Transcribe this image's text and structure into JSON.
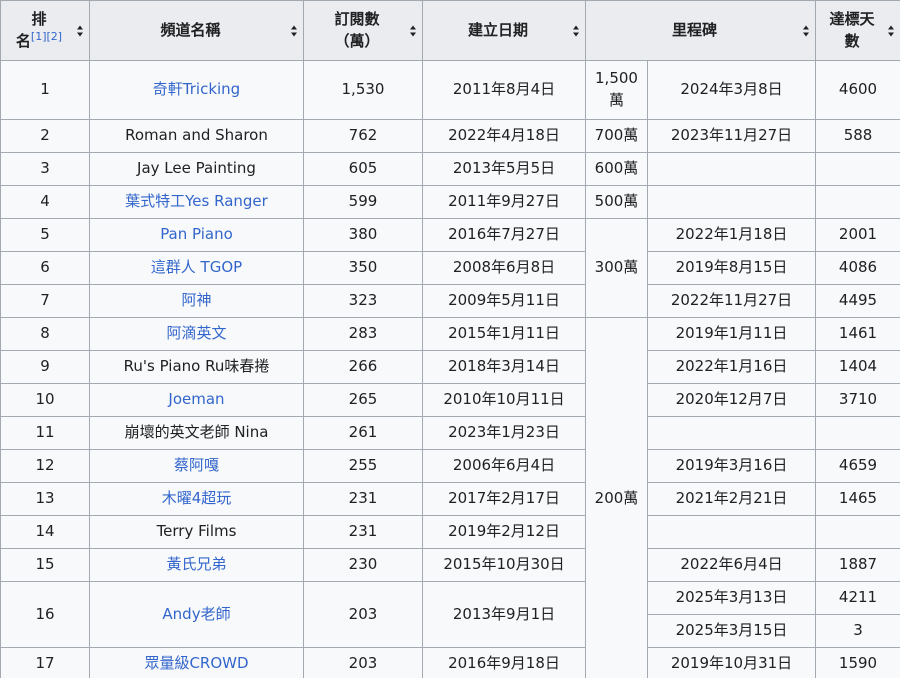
{
  "headers": {
    "rank_line1": "排",
    "rank_line2": "名",
    "rank_ref1": "[1]",
    "rank_ref2": "[2]",
    "channel": "頻道名稱",
    "subs_line1": "訂閱數",
    "subs_line2": "（萬）",
    "created": "建立日期",
    "milestone": "里程碑",
    "days_line1": "達標天",
    "days_line2": "數"
  },
  "milestone_groups": {
    "m1500_line1": "1,500",
    "m1500_line2": "萬",
    "m700": "700萬",
    "m600": "600萬",
    "m500": "500萬",
    "m300": "300萬",
    "m200": "200萬"
  },
  "rows": [
    {
      "rank": "1",
      "channel": "奇軒Tricking",
      "subs": "1,530",
      "created": "2011年8月4日",
      "date": "2024年3月8日",
      "days": "4600"
    },
    {
      "rank": "2",
      "channel": "Roman and Sharon",
      "subs": "762",
      "created": "2022年4月18日",
      "date": "2023年11月27日",
      "days": "588"
    },
    {
      "rank": "3",
      "channel": "Jay Lee Painting",
      "subs": "605",
      "created": "2013年5月5日",
      "date": "",
      "days": ""
    },
    {
      "rank": "4",
      "channel": "葉式特工Yes Ranger",
      "subs": "599",
      "created": "2011年9月27日",
      "date": "",
      "days": ""
    },
    {
      "rank": "5",
      "channel": "Pan Piano",
      "subs": "380",
      "created": "2016年7月27日",
      "date": "2022年1月18日",
      "days": "2001"
    },
    {
      "rank": "6",
      "channel": "這群人 TGOP",
      "subs": "350",
      "created": "2008年6月8日",
      "date": "2019年8月15日",
      "days": "4086"
    },
    {
      "rank": "7",
      "channel": "阿神",
      "subs": "323",
      "created": "2009年5月11日",
      "date": "2022年11月27日",
      "days": "4495"
    },
    {
      "rank": "8",
      "channel": "阿滴英文",
      "subs": "283",
      "created": "2015年1月11日",
      "date": "2019年1月11日",
      "days": "1461"
    },
    {
      "rank": "9",
      "channel": "Ru's Piano Ru味春捲",
      "subs": "266",
      "created": "2018年3月14日",
      "date": "2022年1月16日",
      "days": "1404"
    },
    {
      "rank": "10",
      "channel": "Joeman",
      "subs": "265",
      "created": "2010年10月11日",
      "date": "2020年12月7日",
      "days": "3710"
    },
    {
      "rank": "11",
      "channel": "崩壞的英文老師 Nina",
      "subs": "261",
      "created": "2023年1月23日",
      "date": "",
      "days": ""
    },
    {
      "rank": "12",
      "channel": "蔡阿嘎",
      "subs": "255",
      "created": "2006年6月4日",
      "date": "2019年3月16日",
      "days": "4659"
    },
    {
      "rank": "13",
      "channel": "木曜4超玩",
      "subs": "231",
      "created": "2017年2月17日",
      "date": "2021年2月21日",
      "days": "1465"
    },
    {
      "rank": "14",
      "channel": "Terry Films",
      "subs": "231",
      "created": "2019年2月12日",
      "date": "",
      "days": ""
    },
    {
      "rank": "15",
      "channel": "黃氏兄弟",
      "subs": "230",
      "created": "2015年10月30日",
      "date": "2022年6月4日",
      "days": "1887"
    },
    {
      "rank": "16",
      "channel": "Andy老師",
      "subs": "203",
      "created": "2013年9月1日",
      "date": "2025年3月13日",
      "days": "4211",
      "date2": "2025年3月15日",
      "days2": "3"
    },
    {
      "rank": "17",
      "channel": "眾量級CROWD",
      "subs": "203",
      "created": "2016年9月18日",
      "date": "2019年10月31日",
      "days": "1590"
    }
  ]
}
